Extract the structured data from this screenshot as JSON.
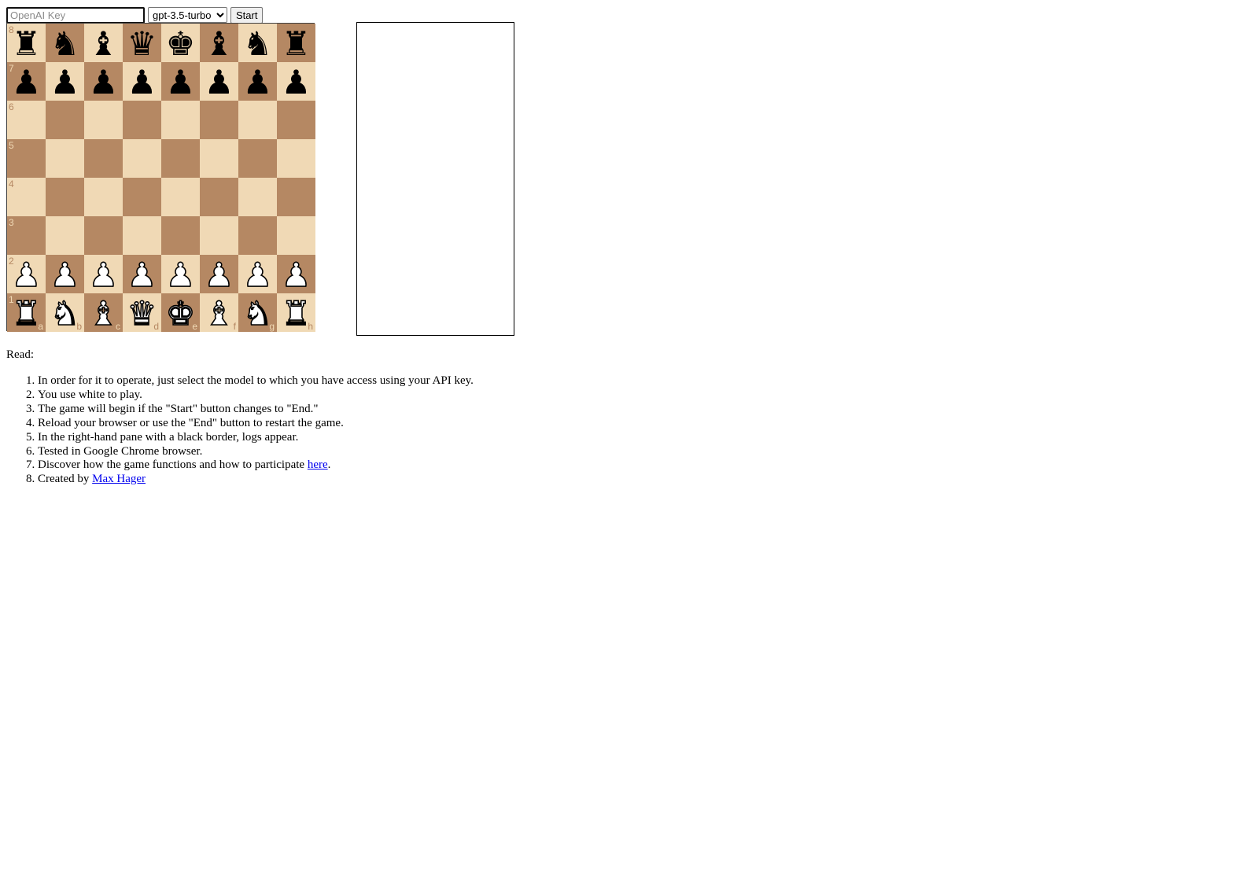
{
  "controls": {
    "key_placeholder": "OpenAI Key",
    "key_value": "",
    "model_selected": "gpt-3.5-turbo",
    "start_label": "Start"
  },
  "board": {
    "files": [
      "a",
      "b",
      "c",
      "d",
      "e",
      "f",
      "g",
      "h"
    ],
    "ranks": [
      "8",
      "7",
      "6",
      "5",
      "4",
      "3",
      "2",
      "1"
    ],
    "light_color": "#f0d9b5",
    "dark_color": "#b58863",
    "position": [
      [
        "r",
        "n",
        "b",
        "q",
        "k",
        "b",
        "n",
        "r"
      ],
      [
        "p",
        "p",
        "p",
        "p",
        "p",
        "p",
        "p",
        "p"
      ],
      [
        "",
        "",
        "",
        "",
        "",
        "",
        "",
        ""
      ],
      [
        "",
        "",
        "",
        "",
        "",
        "",
        "",
        ""
      ],
      [
        "",
        "",
        "",
        "",
        "",
        "",
        "",
        ""
      ],
      [
        "",
        "",
        "",
        "",
        "",
        "",
        "",
        ""
      ],
      [
        "P",
        "P",
        "P",
        "P",
        "P",
        "P",
        "P",
        "P"
      ],
      [
        "R",
        "N",
        "B",
        "Q",
        "K",
        "B",
        "N",
        "R"
      ]
    ]
  },
  "instructions": {
    "heading": "Read:",
    "items": [
      "In order for it to operate, just select the model to which you have access using your API key.",
      "You use white to play.",
      "The game will begin if the \"Start\" button changes to \"End.\"",
      "Reload your browser or use the \"End\" button to restart the game.",
      "In the right-hand pane with a black border, logs appear.",
      "Tested in Google Chrome browser."
    ],
    "discover_text": "Discover how the game functions and how to participate ",
    "discover_link": "here",
    "discover_end": ".",
    "created_text": "Created by ",
    "created_link": "Max Hager"
  }
}
